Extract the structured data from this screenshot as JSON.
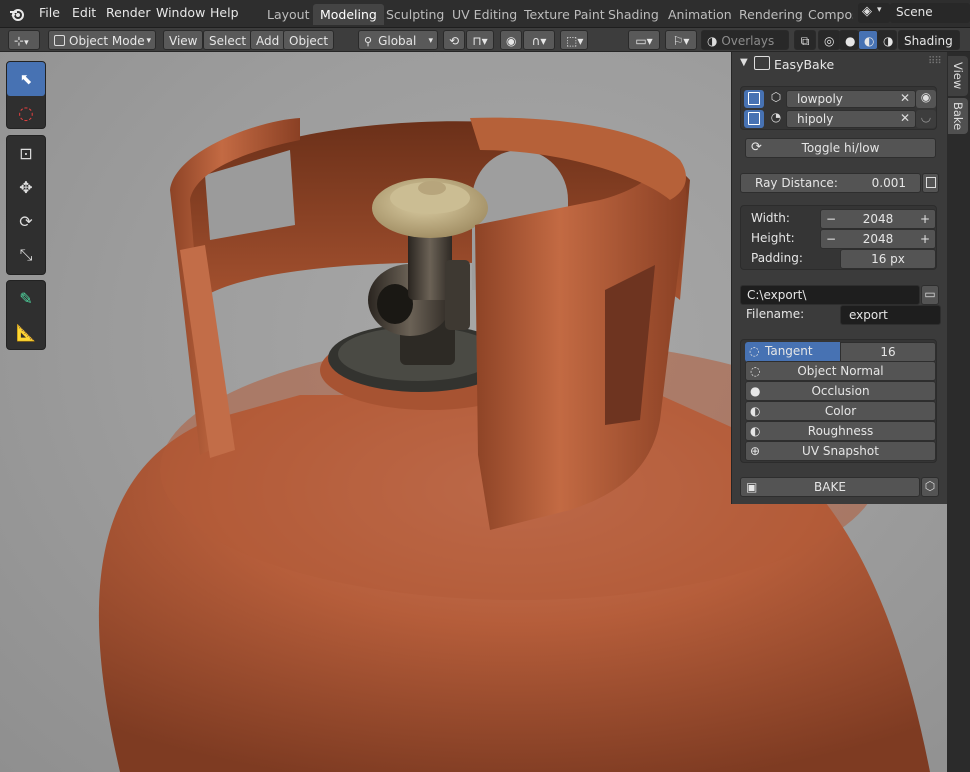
{
  "menu": {
    "file": "File",
    "edit": "Edit",
    "render": "Render",
    "window": "Window",
    "help": "Help"
  },
  "workspaces": [
    {
      "label": "Layout",
      "active": false
    },
    {
      "label": "Modeling",
      "active": true
    },
    {
      "label": "Sculpting",
      "active": false
    },
    {
      "label": "UV Editing",
      "active": false
    },
    {
      "label": "Texture Paint",
      "active": false
    },
    {
      "label": "Shading",
      "active": false
    },
    {
      "label": "Animation",
      "active": false
    },
    {
      "label": "Rendering",
      "active": false
    },
    {
      "label": "Compos",
      "active": false
    }
  ],
  "scene": {
    "name": "Scene"
  },
  "header": {
    "mode": "Object Mode",
    "view": "View",
    "select": "Select",
    "add": "Add",
    "object": "Object",
    "orientation": "Global",
    "overlays": "Overlays",
    "shading": "Shading"
  },
  "side_tabs": {
    "view": "View",
    "bake": "Bake"
  },
  "panel": {
    "title": "EasyBake",
    "lowpoly": "lowpoly",
    "hipoly": "hipoly",
    "toggle": "Toggle hi/low",
    "ray_distance_label": "Ray Distance:",
    "ray_distance": "0.001",
    "width_label": "Width:",
    "width": "2048",
    "height_label": "Height:",
    "height": "2048",
    "padding_label": "Padding:",
    "padding": "16 px",
    "path": "C:\\export\\",
    "filename_label": "Filename:",
    "filename": "export",
    "maps": {
      "tangent": "Tangent Nor..",
      "tangent_value": "16",
      "object_normal": "Object Normal",
      "occlusion": "Occlusion",
      "color": "Color",
      "roughness": "Roughness",
      "uv": "UV Snapshot"
    },
    "bake": "BAKE"
  },
  "colors": {
    "accent": "#4772b3",
    "cylinder": "#b8603a",
    "cap": "#c9b78b"
  }
}
